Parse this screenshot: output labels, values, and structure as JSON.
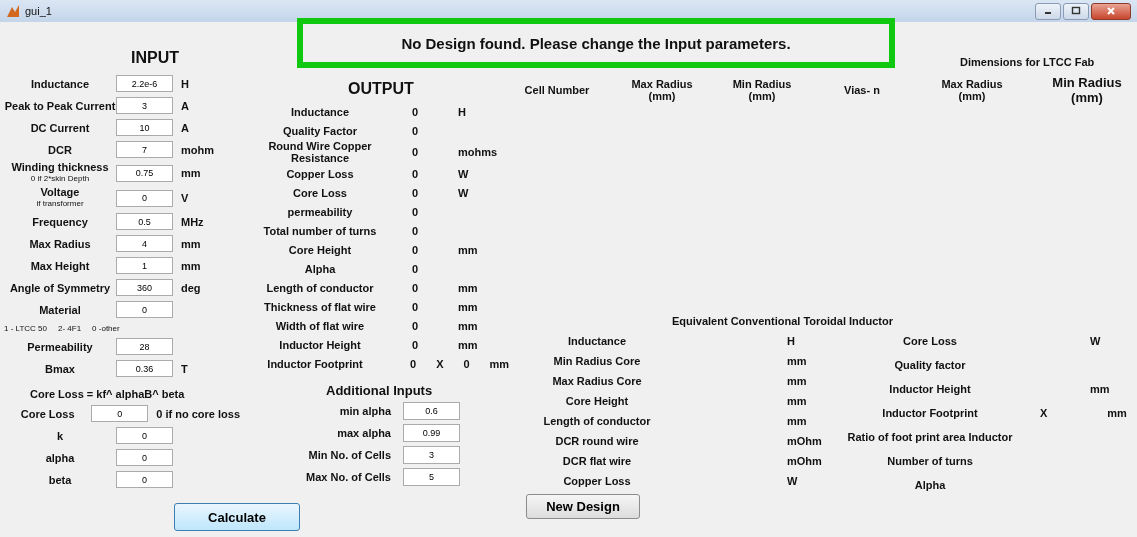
{
  "window": {
    "title": "gui_1"
  },
  "message": "No Design found. Please change the Input parameters.",
  "input": {
    "heading": "INPUT",
    "fields": [
      {
        "label": "Inductance",
        "value": "2.2e-6",
        "unit": "H"
      },
      {
        "label": "Peak to Peak Current",
        "value": "3",
        "unit": "A"
      },
      {
        "label": "DC Current",
        "value": "10",
        "unit": "A"
      },
      {
        "label": "DCR",
        "value": "7",
        "unit": "mohm"
      },
      {
        "label": "Winding thickness",
        "hint": "0 if 2*skin Depth",
        "value": "0.75",
        "unit": "mm"
      },
      {
        "label": "Voltage",
        "hint": "if transformer",
        "value": "0",
        "unit": "V"
      },
      {
        "label": "Frequency",
        "value": "0.5",
        "unit": "MHz"
      },
      {
        "label": "Max Radius",
        "value": "4",
        "unit": "mm"
      },
      {
        "label": "Max Height",
        "value": "1",
        "unit": "mm"
      },
      {
        "label": "Angle of Symmetry",
        "value": "360",
        "unit": "deg"
      },
      {
        "label": "Material",
        "value": "0",
        "legend": [
          "1 - LTCC 50",
          "2- 4F1",
          "0 -other"
        ]
      },
      {
        "label": "Permeability",
        "value": "28"
      },
      {
        "label": "Bmax",
        "value": "0.36",
        "unit": "T"
      }
    ],
    "formula": "Core Loss = kf^ alphaB^ beta",
    "loss_fields": [
      {
        "label": "Core Loss",
        "value": "0",
        "unit": "0 if no core loss"
      },
      {
        "label": "k",
        "value": "0"
      },
      {
        "label": "alpha",
        "value": "0"
      },
      {
        "label": "beta",
        "value": "0"
      }
    ],
    "button": "Calculate"
  },
  "output": {
    "heading": "OUTPUT",
    "rows": [
      {
        "label": "Inductance",
        "value": "0",
        "unit": "H"
      },
      {
        "label": "Quality Factor",
        "value": "0"
      },
      {
        "label": "Round Wire Copper Resistance",
        "value": "0",
        "unit": "mohms"
      },
      {
        "label": "Copper Loss",
        "value": "0",
        "unit": "W"
      },
      {
        "label": "Core Loss",
        "value": "0",
        "unit": "W"
      },
      {
        "label": "permeability",
        "value": "0"
      },
      {
        "label": "Total number of turns",
        "value": "0"
      },
      {
        "label": "Core Height",
        "value": "0",
        "unit": "mm"
      },
      {
        "label": "Alpha",
        "value": "0"
      },
      {
        "label": "Length of conductor",
        "value": "0",
        "unit": "mm"
      },
      {
        "label": "Thickness of flat wire",
        "value": "0",
        "unit": "mm"
      },
      {
        "label": "Width of flat wire",
        "value": "0",
        "unit": "mm"
      },
      {
        "label": "Inductor Height",
        "value": "0",
        "unit": "mm"
      }
    ],
    "footprint": {
      "label": "Inductor Footprint",
      "value_1": "0",
      "separator": "X",
      "value_2": "0",
      "unit": "mm"
    }
  },
  "additional_inputs": {
    "heading": "Additional Inputs",
    "fields": [
      {
        "label": "min alpha",
        "value": "0.6"
      },
      {
        "label": "max alpha",
        "value": "0.99"
      },
      {
        "label": "Min No. of Cells",
        "value": "3"
      },
      {
        "label": "Max No. of Cells",
        "value": "5"
      }
    ]
  },
  "new_design_button": "New Design",
  "cells_table": {
    "ltcc_title": "Dimensions for LTCC Fab",
    "columns": [
      "Cell Number",
      "Max Radius (mm)",
      "Min Radius (mm)",
      "Vias- n",
      "Max Radius (mm)",
      "Min Radius (mm)"
    ]
  },
  "toroidal": {
    "title": "Equivalent Conventional Toroidal Inductor",
    "left": [
      {
        "label": "Inductance",
        "unit": "H"
      },
      {
        "label": "Min Radius Core",
        "unit": "mm"
      },
      {
        "label": "Max Radius Core",
        "unit": "mm"
      },
      {
        "label": "Core Height",
        "unit": "mm"
      },
      {
        "label": "Length of conductor",
        "unit": "mm"
      },
      {
        "label": "DCR round wire",
        "unit": "mOhm"
      },
      {
        "label": "DCR flat wire",
        "unit": "mOhm"
      },
      {
        "label": "Copper Loss",
        "unit": "W"
      }
    ],
    "right": [
      {
        "label": "Core Loss",
        "unit": "W"
      },
      {
        "label": "Quality factor"
      },
      {
        "label": "Inductor Height",
        "unit": "mm"
      },
      {
        "label": "Inductor Footprint",
        "separator": "X",
        "unit": "mm"
      },
      {
        "label": "Ratio of foot print area Inductor"
      },
      {
        "label": "Number of turns"
      },
      {
        "label": "Alpha"
      }
    ]
  }
}
